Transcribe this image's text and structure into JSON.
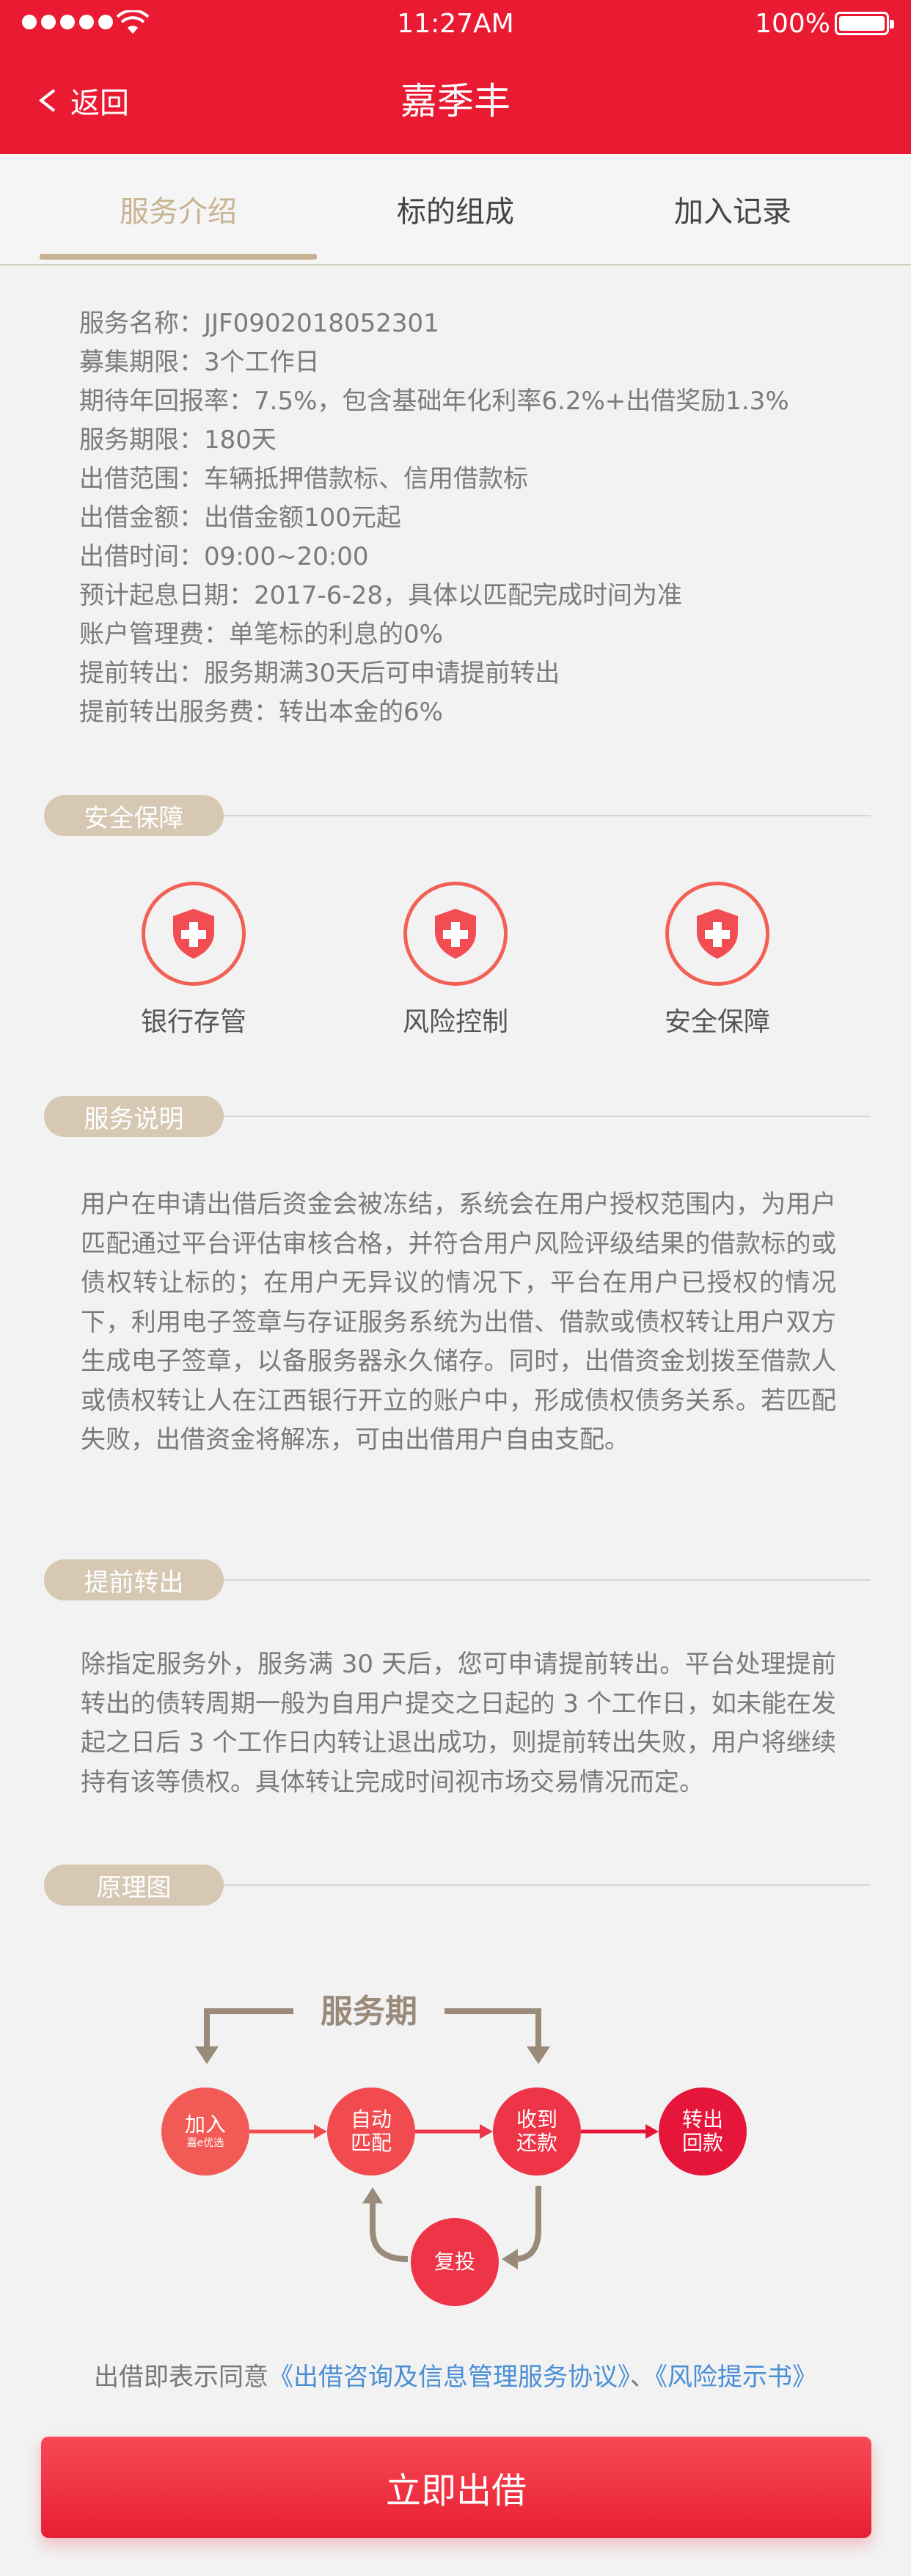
{
  "status": {
    "time": "11:27AM",
    "battery": "100%"
  },
  "header": {
    "back_label": "返回",
    "title": "嘉季丰"
  },
  "tabs": [
    {
      "label": "服务介绍"
    },
    {
      "label": "标的组成"
    },
    {
      "label": "加入记录"
    }
  ],
  "info": [
    "服务名称：JJF0902018052301",
    "募集期限：3个工作日",
    "期待年回报率：7.5%，包含基础年化利率6.2%+出借奖励1.3%",
    "服务期限：180天",
    "出借范围：车辆抵押借款标、信用借款标",
    "出借金额：出借金额100元起",
    "出借时间：09:00~20:00",
    "预计起息日期：2017-6-28，具体以匹配完成时间为准",
    "账户管理费：单笔标的利息的0%",
    "提前转出：服务期满30天后可申请提前转出",
    "提前转出服务费：转出本金的6%"
  ],
  "sections": {
    "security": "安全保障",
    "service_desc": "服务说明",
    "early_exit": "提前转出",
    "principle": "原理图"
  },
  "features": [
    {
      "label": "银行存管",
      "icon": "shield-cross-icon"
    },
    {
      "label": "风险控制",
      "icon": "shield-cross-icon"
    },
    {
      "label": "安全保障",
      "icon": "shield-cross-icon"
    }
  ],
  "service_desc_text": "用户在申请出借后资金会被冻结，系统会在用户授权范围内，为用户匹配通过平台评估审核合格，并符合用户风险评级结果的借款标的或债权转让标的；在用户无异议的情况下，平台在用户已授权的情况下，利用电子签章与存证服务系统为出借、借款或债权转让用户双方生成电子签章，以备服务器永久储存。同时，出借资金划拨至借款人或债权转让人在江西银行开立的账户中，形成债权债务关系。若匹配失败，出借资金将解冻，可由出借用户自由支配。",
  "early_exit_text": "除指定服务外，服务满 30 天后，您可申请提前转出。平台处理提前转出的债转周期一般为自用户提交之日起的 3 个工作日，如未能在发起之日后 3 个工作日内转让退出成功，则提前转出失败，用户将继续持有该等债权。具体转让完成时间视市场交易情况而定。",
  "diagram": {
    "period_label": "服务期",
    "nodes": [
      {
        "line1": "加入",
        "line2": "嘉e优选"
      },
      {
        "line1": "自动",
        "line2": "匹配"
      },
      {
        "line1": "收到",
        "line2": "还款"
      },
      {
        "line1": "转出",
        "line2": "回款"
      }
    ],
    "reinvest": "复投"
  },
  "agreement": {
    "prefix": "出借即表示同意",
    "link1": "《出借咨询及信息管理服务协议》",
    "sep": "、",
    "link2": "《风险提示书》"
  },
  "button": {
    "label": "立即出借"
  },
  "colors": {
    "primary": "#ea1a33",
    "accent": "#c6b293",
    "link": "#4a8fd6"
  }
}
